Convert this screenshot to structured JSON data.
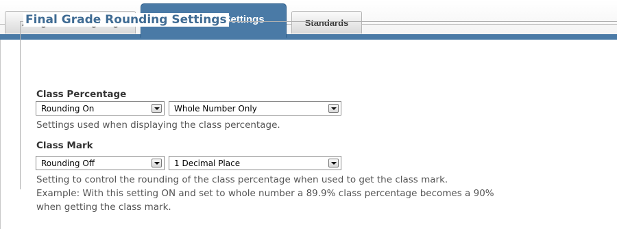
{
  "tabs": [
    {
      "label": "Assignment Weighting",
      "active": false
    },
    {
      "label": "Grade Book Settings",
      "active": true
    },
    {
      "label": "Standards",
      "active": false
    }
  ],
  "section": {
    "title": "Final Grade Rounding Settings"
  },
  "class_percentage": {
    "label": "Class Percentage",
    "rounding_select": "Rounding On",
    "precision_select": "Whole Number Only",
    "help": "Settings used when displaying the class percentage."
  },
  "class_mark": {
    "label": "Class Mark",
    "rounding_select": "Rounding Off",
    "precision_select": "1 Decimal Place",
    "help_lines": [
      "Setting to control the rounding of the class percentage when used to get the class mark.",
      "Example: With this setting ON and set to whole number a 89.9% class percentage becomes a 90%",
      "when getting the class mark."
    ]
  },
  "colors": {
    "accent": "#4a7aa6",
    "legend_text": "#3f6b93"
  }
}
